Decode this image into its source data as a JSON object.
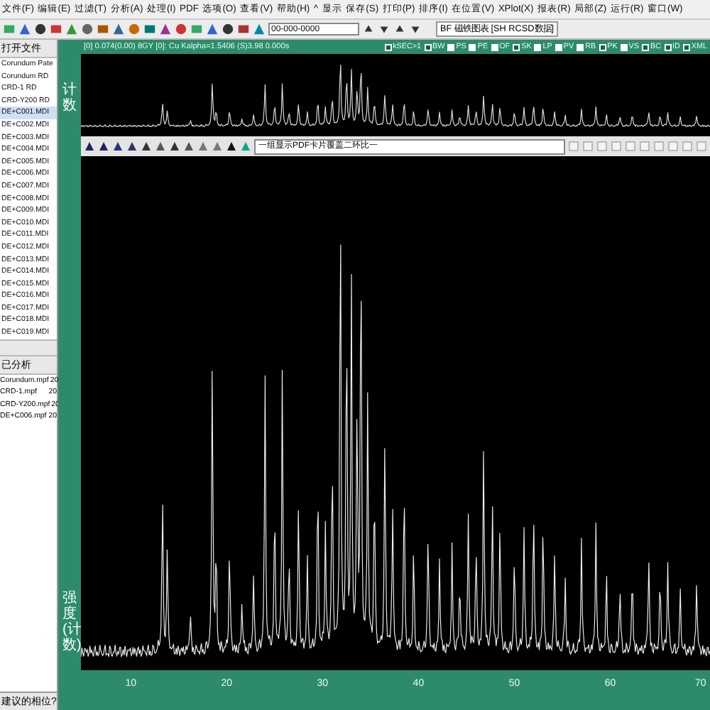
{
  "menu": [
    "文件(F)",
    "编辑(E)",
    "过滤(T)",
    "分析(A)",
    "处理(I)",
    "PDF",
    "选项(O)",
    "查看(V)",
    "帮助(H)",
    "^",
    "显示",
    "保存(S)",
    "打印(P)",
    "排序(I)",
    "在位置(V)",
    "XPlot(X)",
    "报表(R)",
    "局部(Z)",
    "运行(R)",
    "窗口(W)"
  ],
  "toolbar": {
    "card_field": "00-000-0000",
    "pdf_label": "BF 磁铁图表 [SH RCSD数据]"
  },
  "status": {
    "text": "[0] 0.074(0.00) 8GY [0]: Cu Kalpha=1.5406 (S)3.98 0.000s"
  },
  "toggles": [
    {
      "label": "kSEC>1",
      "checked": false
    },
    {
      "label": "BW",
      "checked": false
    },
    {
      "label": "PS",
      "checked": true
    },
    {
      "label": "PE",
      "checked": true
    },
    {
      "label": "OF",
      "checked": true
    },
    {
      "label": "SK",
      "checked": false
    },
    {
      "label": "LP",
      "checked": true
    },
    {
      "label": "PV",
      "checked": true
    },
    {
      "label": "RB",
      "checked": true
    },
    {
      "label": "PK",
      "checked": false
    },
    {
      "label": "VS",
      "checked": true
    },
    {
      "label": "BC",
      "checked": false
    },
    {
      "label": "ID",
      "checked": false
    },
    {
      "label": "XML",
      "checked": false
    }
  ],
  "sidebar": {
    "header": "打开文件",
    "files": [
      {
        "name": "Corundum Pate",
        "selected": false
      },
      {
        "name": "Corundum RD",
        "selected": false
      },
      {
        "name": "CRD-1 RD",
        "selected": false
      },
      {
        "name": "CRD-Y200 RD",
        "selected": false
      },
      {
        "name": "DE+C001.MDI",
        "selected": true
      },
      {
        "name": "DE+C002.MDI",
        "selected": false
      },
      {
        "name": "DE+C003.MDI",
        "selected": false
      },
      {
        "name": "DE+C004.MDI",
        "selected": false
      },
      {
        "name": "DE+C005.MDI",
        "selected": false
      },
      {
        "name": "DE+C006.MDI",
        "selected": false
      },
      {
        "name": "DE+C007.MDI",
        "selected": false
      },
      {
        "name": "DE+C008.MDI",
        "selected": false
      },
      {
        "name": "DE+C009.MDI",
        "selected": false
      },
      {
        "name": "DE+C010.MDI",
        "selected": false
      },
      {
        "name": "DE+C011.MDI",
        "selected": false
      },
      {
        "name": "DE+C012.MDI",
        "selected": false
      },
      {
        "name": "DE+C013.MDI",
        "selected": false
      },
      {
        "name": "DE+C014.MDI",
        "selected": false
      },
      {
        "name": "DE+C015.MDI",
        "selected": false
      },
      {
        "name": "DE+C016.MDI",
        "selected": false
      },
      {
        "name": "DE+C017.MDI",
        "selected": false
      },
      {
        "name": "DE+C018.MDI",
        "selected": false
      },
      {
        "name": "DE+C019.MDI",
        "selected": false
      }
    ],
    "lower_header": "已分析",
    "lower_files": [
      {
        "name": "Corundum.mpf",
        "column_2": "20"
      },
      {
        "name": "CRD-1.mpf",
        "column_2": "20"
      },
      {
        "name": "CRD-Y200.mpf",
        "column_2": "20"
      },
      {
        "name": "DE+C006.mpf",
        "column_2": "20"
      }
    ],
    "footer": "建议的相位?"
  },
  "plot": {
    "top_label": "计数",
    "overlay_field": "一组显示PDF卡片覆盖二环比一",
    "y_label": "强度(计数)",
    "x_ticks": [
      "10",
      "20",
      "30",
      "40",
      "50",
      "60",
      "70"
    ]
  }
}
